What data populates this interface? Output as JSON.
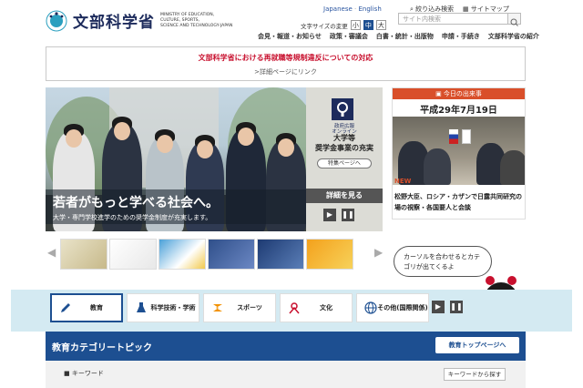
{
  "header": {
    "logo_text": "文部科学省",
    "logo_en_lines": [
      "MINISTRY OF EDUCATION,",
      "CULTURE, SPORTS,",
      "SCIENCE AND TECHNOLOGY-JAPAN"
    ],
    "lang_japanese": "Japanese",
    "lang_english": "English",
    "sitesearch": "絞り込み検索",
    "sitemap": "サイトマップ",
    "fontsize_label": "文字サイズの変更",
    "fontsize_small": "小",
    "fontsize_medium": "中",
    "fontsize_large": "大",
    "search_placeholder": "サイト内検索"
  },
  "gnav": [
    "会見・報道・お知らせ",
    "政策・審議会",
    "白書・統計・出版物",
    "申請・手続き",
    "文部科学省の紹介"
  ],
  "notice": {
    "title": "文部科学省における再就職等規制違反についての対応",
    "link": ">詳細ページにリンク"
  },
  "hero": {
    "title": "若者がもっと学べる社会へ。",
    "subtitle": "大学・専門学校進学のための奨学金制度が充実します。",
    "side_small_1": "政府広報",
    "side_small_2": "オンライン",
    "side_title_1": "大学等",
    "side_title_2": "奨学金事業の充実",
    "side_pill": "特集ページへ",
    "detail_button": "詳細を見る"
  },
  "today": {
    "header": "今日の出来事",
    "date": "平成29年7月19日",
    "badge": "NEW",
    "text": "松野大臣、ロシア・カザンで日露共同研究の場の視察・各国要人と会談"
  },
  "bubble": "カーソルを合わせるとカテゴリが出てくるよ",
  "categories": [
    {
      "label": "教育"
    },
    {
      "label": "科学技術・学術"
    },
    {
      "label": "スポーツ"
    },
    {
      "label": "文化"
    },
    {
      "label": "その他(国際関係)"
    }
  ],
  "topic": {
    "title": "教育カテゴリートピック",
    "button": "教育トップページへ",
    "keyword_label": "■ キーワード",
    "keyword_button": "キーワードから探す"
  },
  "colors": {
    "brand_navy": "#1d4f91",
    "notice_red": "#c8102e",
    "today_orange": "#d94f2a"
  }
}
